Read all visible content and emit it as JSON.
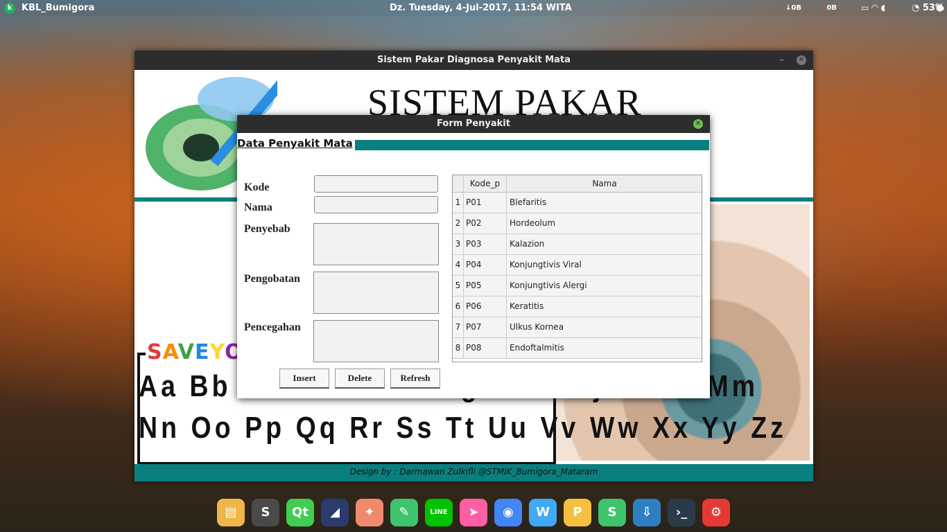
{
  "topbar": {
    "hostname": "KBL_Bumigora",
    "datetime": "Dz. Tuesday,  4-Jul-2017, 11:54 WITA",
    "net_down": "0B",
    "net_up": "0B",
    "battery": "53%"
  },
  "main_window": {
    "title": "Sistem Pakar Diagnosa Penyakit Mata",
    "banner_title": "SISTEM PAKAR",
    "poster_heading": "SaveYou",
    "alphabet_row1": "Aa Bb Cc Dd Ee Ff Gg Hh Ii Jj Kk Ll Mm",
    "alphabet_row2": "Nn Oo Pp Qq Rr Ss Tt Uu Vv Ww Xx Yy Zz",
    "footer": "Design by : Darmawan Zulkifli @STMIK_Bumigora_Mataram"
  },
  "dialog": {
    "title": "Form Penyakit",
    "heading": "Data Penyakit Mata",
    "labels": {
      "kode": "Kode",
      "nama": "Nama",
      "penyebab": "Penyebab",
      "pengobatan": "Pengobatan",
      "pencegahan": "Pencegahan"
    },
    "buttons": {
      "insert": "Insert",
      "delete": "Delete",
      "refresh": "Refresh"
    },
    "table": {
      "columns": [
        "Kode_p",
        "Nama"
      ],
      "rows": [
        {
          "n": "1",
          "kode": "P01",
          "nama": "Blefaritis"
        },
        {
          "n": "2",
          "kode": "P02",
          "nama": "Hordeolum"
        },
        {
          "n": "3",
          "kode": "P03",
          "nama": "Kalazion"
        },
        {
          "n": "4",
          "kode": "P04",
          "nama": "Konjungtivis Viral"
        },
        {
          "n": "5",
          "kode": "P05",
          "nama": "Konjungtivis Alergi"
        },
        {
          "n": "6",
          "kode": "P06",
          "nama": "Keratitis"
        },
        {
          "n": "7",
          "kode": "P07",
          "nama": "Ulkus Kornea"
        },
        {
          "n": "8",
          "kode": "P08",
          "nama": "Endoftalmitis"
        }
      ]
    }
  },
  "dock": [
    {
      "icon": "files-icon",
      "color": "#f0b64a"
    },
    {
      "icon": "sublime-text-icon",
      "color": "#4a4a4a"
    },
    {
      "icon": "qt-creator-icon",
      "color": "#41cd52"
    },
    {
      "icon": "mysql-workbench-icon",
      "color": "#2a3b6e"
    },
    {
      "icon": "inkscape-icon",
      "color": "#f08a6c"
    },
    {
      "icon": "screenshot-icon",
      "color": "#3ec46d"
    },
    {
      "icon": "line-icon",
      "color": "#00c300"
    },
    {
      "icon": "wps-presentation-icon",
      "color": "#ff5fa2"
    },
    {
      "icon": "chromium-icon",
      "color": "#4285f4"
    },
    {
      "icon": "wps-writer-icon",
      "color": "#3fa9f5"
    },
    {
      "icon": "wps-presentation-p-icon",
      "color": "#f5c040"
    },
    {
      "icon": "wps-spreadsheet-icon",
      "color": "#3ec46d"
    },
    {
      "icon": "installer-icon",
      "color": "#2d7fc1"
    },
    {
      "icon": "terminal-icon",
      "color": "#2b3a4a"
    },
    {
      "icon": "settings-icon",
      "color": "#e53935"
    }
  ]
}
